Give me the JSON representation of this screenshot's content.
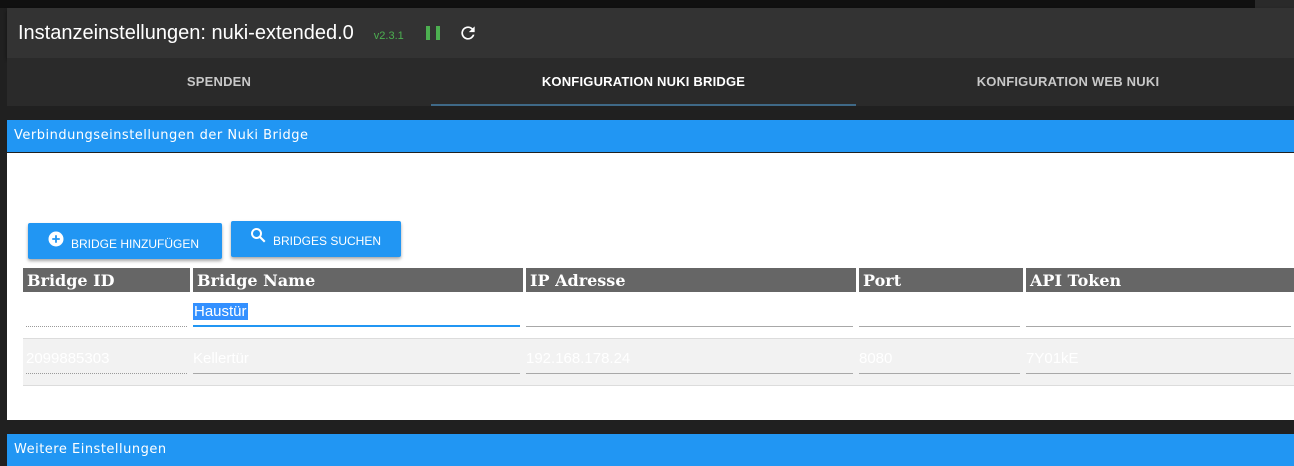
{
  "header": {
    "title": "Instanzeinstellungen: nuki-extended.0",
    "version": "v2.3.1"
  },
  "tabs": [
    {
      "label": "SPENDEN"
    },
    {
      "label": "KONFIGURATION NUKI BRIDGE"
    },
    {
      "label": "KONFIGURATION WEB NUKI"
    }
  ],
  "sections": {
    "connection": "Verbindungseinstellungen der Nuki Bridge",
    "further": "Weitere Einstellungen"
  },
  "buttons": {
    "add_bridge": "BRIDGE HINZUFÜGEN",
    "search_bridges": "BRIDGES SUCHEN"
  },
  "table": {
    "columns": [
      "Bridge ID",
      "Bridge Name",
      "IP Adresse",
      "Port",
      "API Token"
    ],
    "rows": [
      {
        "bridge_id": "",
        "bridge_name": "Haustür",
        "ip": "",
        "port": "",
        "token": ""
      },
      {
        "bridge_id": "2099885303",
        "bridge_name": "Kellertür",
        "ip": "192.168.178.24",
        "port": "8080",
        "token": "7Y01kE"
      }
    ]
  },
  "colors": {
    "accent": "#2196f3",
    "status_green": "#4caf50",
    "titlebar": "#333333",
    "table_header": "#666666"
  }
}
